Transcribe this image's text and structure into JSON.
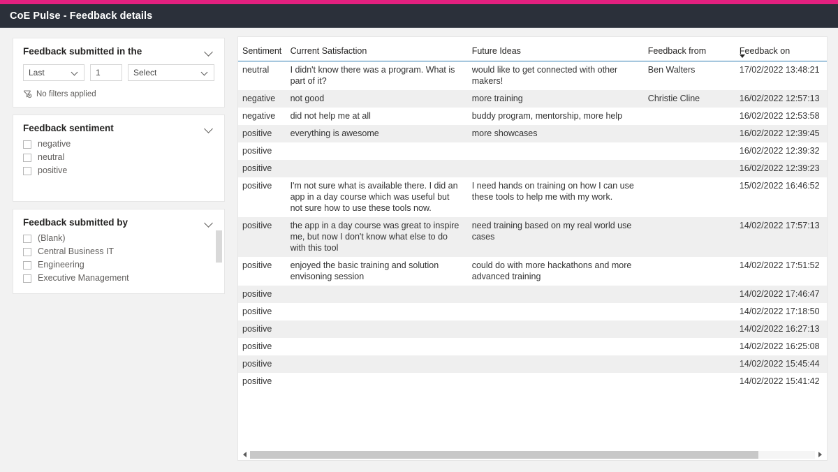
{
  "window": {
    "accent_color": "#e3207f",
    "titlebar_color": "#2b303a",
    "title": "CoE Pulse - Feedback details"
  },
  "filters": {
    "date_card": {
      "title": "Feedback submitted in the",
      "collapse_icon": "chevron-down-icon",
      "relation_value": "Last",
      "count_value": "1",
      "unit_placeholder": "Select",
      "status_icon": "filter-clock-icon",
      "status_text": "No filters applied"
    },
    "sentiment_card": {
      "title": "Feedback sentiment",
      "collapse_icon": "chevron-down-icon",
      "options": [
        {
          "label": "negative",
          "checked": false
        },
        {
          "label": "neutral",
          "checked": false
        },
        {
          "label": "positive",
          "checked": false
        }
      ]
    },
    "submitted_by_card": {
      "title": "Feedback submitted by",
      "collapse_icon": "chevron-down-icon",
      "options": [
        {
          "label": "(Blank)",
          "checked": false
        },
        {
          "label": "Central Business IT",
          "checked": false
        },
        {
          "label": "Engineering",
          "checked": false
        },
        {
          "label": "Executive Management",
          "checked": false
        }
      ]
    }
  },
  "table": {
    "columns": [
      {
        "key": "sentiment",
        "label": "Sentiment",
        "sorted": false
      },
      {
        "key": "current",
        "label": "Current Satisfaction",
        "sorted": false
      },
      {
        "key": "future",
        "label": "Future Ideas",
        "sorted": false
      },
      {
        "key": "from",
        "label": "Feedback from",
        "sorted": false
      },
      {
        "key": "on",
        "label": "Feedback on",
        "sorted": true,
        "sort_direction": "descending"
      }
    ],
    "rows": [
      {
        "sentiment": "neutral",
        "current": "I didn't know there was a program. What is part of it?",
        "future": "would like to get connected with other makers!",
        "from": "Ben Walters",
        "on": "17/02/2022 13:48:21"
      },
      {
        "sentiment": "negative",
        "current": "not good",
        "future": "more training",
        "from": "Christie Cline",
        "on": "16/02/2022 12:57:13"
      },
      {
        "sentiment": "negative",
        "current": "did not help me at all",
        "future": "buddy program, mentorship, more help",
        "from": "",
        "on": "16/02/2022 12:53:58"
      },
      {
        "sentiment": "positive",
        "current": "everything is awesome",
        "future": "more showcases",
        "from": "",
        "on": "16/02/2022 12:39:45"
      },
      {
        "sentiment": "positive",
        "current": "",
        "future": "",
        "from": "",
        "on": "16/02/2022 12:39:32"
      },
      {
        "sentiment": "positive",
        "current": "",
        "future": "",
        "from": "",
        "on": "16/02/2022 12:39:23"
      },
      {
        "sentiment": "positive",
        "current": "I'm not sure what is available there. I did an app in a day course which was useful but not sure how to use these tools now.",
        "future": "I need hands on training on how I can use these tools to help me with my work.",
        "from": "",
        "on": "15/02/2022 16:46:52"
      },
      {
        "sentiment": "positive",
        "current": "the app in a day course was great to inspire me, but now I don't know what else to do with this tool",
        "future": "need training based on my real world use cases",
        "from": "",
        "on": "14/02/2022 17:57:13"
      },
      {
        "sentiment": "positive",
        "current": "enjoyed the basic training and solution envisoning session",
        "future": "could do with more hackathons and more advanced training",
        "from": "",
        "on": "14/02/2022 17:51:52"
      },
      {
        "sentiment": "positive",
        "current": "",
        "future": "",
        "from": "",
        "on": "14/02/2022 17:46:47"
      },
      {
        "sentiment": "positive",
        "current": "",
        "future": "",
        "from": "",
        "on": "14/02/2022 17:18:50"
      },
      {
        "sentiment": "positive",
        "current": "",
        "future": "",
        "from": "",
        "on": "14/02/2022 16:27:13"
      },
      {
        "sentiment": "positive",
        "current": "",
        "future": "",
        "from": "",
        "on": "14/02/2022 16:25:08"
      },
      {
        "sentiment": "positive",
        "current": "",
        "future": "",
        "from": "",
        "on": "14/02/2022 15:45:44"
      },
      {
        "sentiment": "positive",
        "current": "",
        "future": "",
        "from": "",
        "on": "14/02/2022 15:41:42"
      }
    ],
    "scrollbar": {
      "left_icon": "chevron-left-icon",
      "right_icon": "chevron-right-icon",
      "thumb_fraction": 0.9
    }
  }
}
